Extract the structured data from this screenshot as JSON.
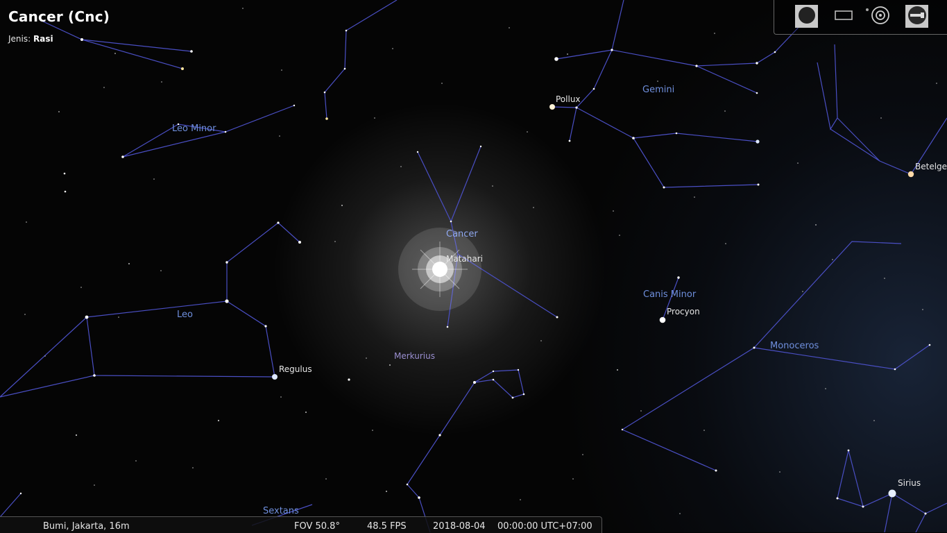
{
  "selected_object": {
    "title": "Cancer (Cnc)",
    "type_label": "Jenis:",
    "type_value": "Rasi"
  },
  "constellation_labels": {
    "leo_minor": "Leo Minor",
    "leo": "Leo",
    "cancer": "Cancer",
    "gemini": "Gemini",
    "canis_minor": "Canis Minor",
    "monoceros": "Monoceros",
    "sextans": "Sextans"
  },
  "object_labels": {
    "pollux": "Pollux",
    "betelgeuse": "Betelge",
    "matahari": "Matahari",
    "procyon": "Procyon",
    "regulus": "Regulus",
    "merkurius": "Merkurius",
    "sirius": "Sirius"
  },
  "status_bar": {
    "location": "Bumi, Jakarta, 16m",
    "fov": "FOV 50.8°",
    "fps": "48.5 FPS",
    "date": "2018-08-04",
    "time": "00:00:00 UTC+07:00"
  },
  "toolbar": {
    "buttons": [
      "fullscreen-toggle",
      "window-toggle",
      "location-target",
      "telescope"
    ]
  },
  "colors": {
    "constellation_line": "#4a4fc4",
    "constellation_label": "#6f8fdd",
    "star_label": "#e6e6e6",
    "planet_label": "#9a8fd0"
  }
}
